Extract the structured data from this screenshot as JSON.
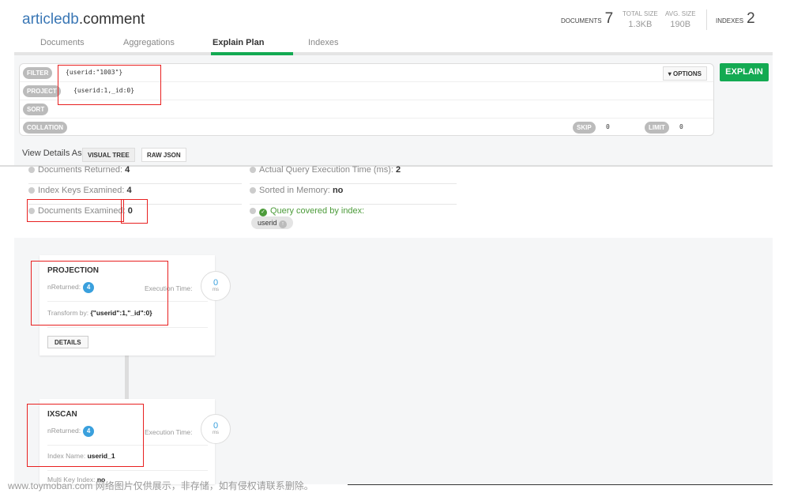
{
  "header": {
    "db": "articledb",
    "collection": ".comment",
    "documents_label": "DOCUMENTS",
    "documents_count": "7",
    "total_size_label": "TOTAL SIZE",
    "total_size": "1.3KB",
    "avg_size_label": "AVG. SIZE",
    "avg_size": "190B",
    "indexes_label": "INDEXES",
    "indexes_count": "2"
  },
  "tabs": [
    {
      "label": "Documents"
    },
    {
      "label": "Aggregations"
    },
    {
      "label": "Explain Plan",
      "active": true
    },
    {
      "label": "Indexes"
    }
  ],
  "query": {
    "filter_label": "FILTER",
    "filter_value": "{userid:\"1003\"}",
    "project_label": "PROJECT",
    "project_value": "{userid:1,_id:0}",
    "sort_label": "SORT",
    "collation_label": "COLLATION",
    "skip_label": "SKIP",
    "skip_value": "0",
    "limit_label": "LIMIT",
    "limit_value": "0",
    "options_label": "▾ OPTIONS",
    "explain_label": "EXPLAIN"
  },
  "view": {
    "label": "View Details As",
    "visual_tree": "VISUAL TREE",
    "raw_json": "RAW JSON"
  },
  "summary": {
    "docs_returned_label": "Documents Returned:",
    "docs_returned": "4",
    "keys_examined_label": "Index Keys Examined:",
    "keys_examined": "4",
    "docs_examined_label": "Documents Examined:",
    "docs_examined": "0",
    "exec_time_label": "Actual Query Execution Time (ms):",
    "exec_time": "2",
    "sorted_label": "Sorted in Memory:",
    "sorted": "no",
    "covered_label": "Query covered by index:",
    "index_field": "userid"
  },
  "stages": [
    {
      "name": "PROJECTION",
      "nreturned_label": "nReturned:",
      "nreturned": "4",
      "exec_label": "Execution Time:",
      "exec_ms": "0",
      "unit": "ms",
      "detail_label": "Transform by:",
      "detail_value": "{\"userid\":1,\"_id\":0}",
      "details_button": "DETAILS"
    },
    {
      "name": "IXSCAN",
      "nreturned_label": "nReturned:",
      "nreturned": "4",
      "exec_label": "Execution Time:",
      "exec_ms": "0",
      "unit": "ms",
      "detail_label": "Index Name:",
      "detail_value": "userid_1",
      "detail2_label": "Multi Key Index:",
      "detail2_value": "no"
    }
  ],
  "watermark": "www.toymoban.com 网络图片仅供展示，非存储，如有侵权请联系删除。",
  "colors": {
    "accent": "#13aa52",
    "link": "#3a77b5",
    "badge": "#3aa0dd",
    "annotation": "#e82020"
  }
}
